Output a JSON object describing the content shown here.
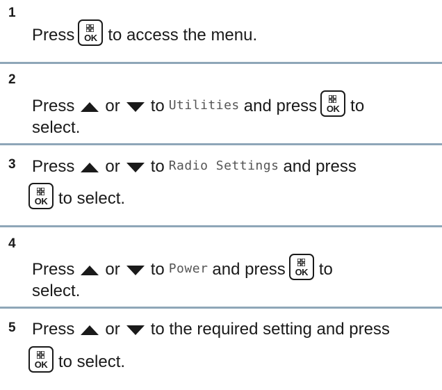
{
  "steps": [
    {
      "number": "1",
      "line1": {
        "pre": "Press",
        "post": "to access the menu."
      }
    },
    {
      "number": "2",
      "line1": {
        "press": "Press",
        "or": "or",
        "to": "to",
        "menu_item": "Utilities",
        "and_press": "and press",
        "post": "to"
      },
      "line2": "select."
    },
    {
      "number": "3",
      "line1": {
        "press": "Press",
        "or": "or",
        "to": "to",
        "menu_item": "Radio Settings",
        "and_press": "and press"
      },
      "line2": "to select."
    },
    {
      "number": "4",
      "line1": {
        "press": "Press",
        "or": "or",
        "to": "to",
        "menu_item": "Power",
        "and_press": "and press",
        "post": "to"
      },
      "line2": "select."
    },
    {
      "number": "5",
      "line1": {
        "press": "Press",
        "or": "or",
        "post": "to the required setting and press"
      },
      "line2": "to select."
    }
  ],
  "keys": {
    "ok_label": "OK",
    "up_icon": "up-arrow-icon",
    "down_icon": "down-arrow-icon",
    "menu_ok_icon": "menu-ok-key-icon"
  },
  "colors": {
    "text": "#1a1a1a",
    "rule": "#8ea6b8",
    "mono_text": "#555555"
  }
}
